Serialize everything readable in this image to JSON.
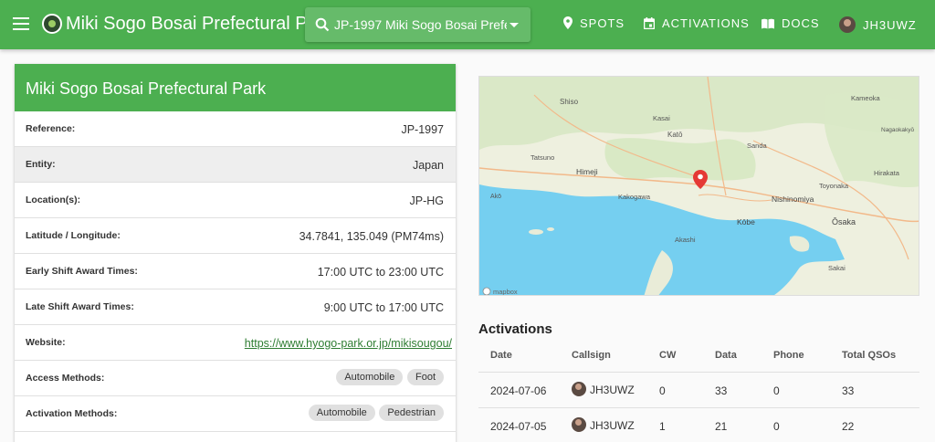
{
  "appbar": {
    "title": "Miki Sogo Bosai Prefectural Park",
    "park_select": "JP-1997  Miki Sogo Bosai Prefectural Park",
    "nav": [
      {
        "label": "SPOTS",
        "icon": "map-marker-icon"
      },
      {
        "label": "ACTIVATIONS",
        "icon": "calendar-icon"
      },
      {
        "label": "DOCS",
        "icon": "book-icon"
      },
      {
        "label": "JH3UWZ",
        "icon": "user-avatar"
      }
    ]
  },
  "park": {
    "header": "Miki Sogo Bosai Prefectural Park",
    "fields": [
      {
        "label": "Reference:",
        "value": "JP-1997"
      },
      {
        "label": "Entity:",
        "value": "Japan"
      },
      {
        "label": "Location(s):",
        "value": "JP-HG"
      },
      {
        "label": "Latitude / Longitude:",
        "value": "34.7841, 135.049 (PM74ms)"
      },
      {
        "label": "Early Shift Award Times:",
        "value": "17:00 UTC to 23:00 UTC"
      },
      {
        "label": "Late Shift Award Times:",
        "value": "9:00 UTC to 17:00 UTC"
      },
      {
        "label": "Website:",
        "value": "https://www.hyogo-park.or.jp/mikisougou/"
      }
    ],
    "access_label": "Access Methods:",
    "access_methods": [
      "Automobile",
      "Foot"
    ],
    "activation_label": "Activation Methods:",
    "activation_methods": [
      "Automobile",
      "Pedestrian"
    ]
  },
  "map": {
    "labels": [
      "Shiso",
      "Kasai",
      "Katō",
      "Sanda",
      "Kameoka",
      "Tatsuno",
      "Himeji",
      "Kakogawa",
      "Nishinomiya",
      "Toyonaka",
      "Hirakata",
      "Kōbe",
      "Ōsaka",
      "Akashi",
      "Sakai",
      "Akō",
      "Nagaokakyō"
    ],
    "attribution": "mapbox"
  },
  "activations": {
    "title": "Activations",
    "columns": [
      "Date",
      "Callsign",
      "CW",
      "Data",
      "Phone",
      "Total QSOs"
    ],
    "rows": [
      {
        "date": "2024-07-06",
        "callsign": "JH3UWZ",
        "cw": "0",
        "data": "33",
        "phone": "0",
        "total": "33"
      },
      {
        "date": "2024-07-05",
        "callsign": "JH3UWZ",
        "cw": "1",
        "data": "21",
        "phone": "0",
        "total": "22"
      }
    ]
  },
  "colors": {
    "primary": "#4caf50",
    "link": "#2e7d32"
  }
}
